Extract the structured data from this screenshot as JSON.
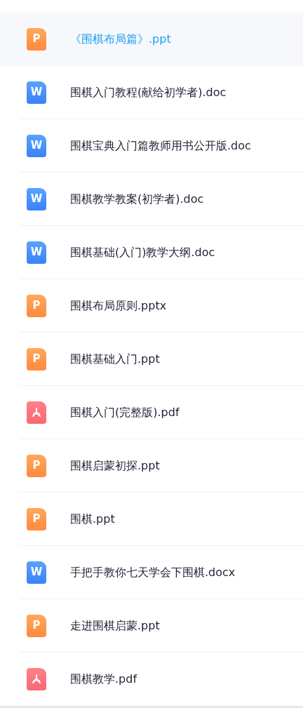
{
  "files": [
    {
      "kind": "ppt",
      "icon_letter": "P",
      "name": "《围棋布局篇》.ppt",
      "selected": true
    },
    {
      "kind": "doc",
      "icon_letter": "W",
      "name": "围棋入门教程(献给初学者).doc",
      "selected": false
    },
    {
      "kind": "doc",
      "icon_letter": "W",
      "name": "围棋宝典入门篇教师用书公开版.doc",
      "selected": false
    },
    {
      "kind": "doc",
      "icon_letter": "W",
      "name": "围棋教学教案(初学者).doc",
      "selected": false
    },
    {
      "kind": "doc",
      "icon_letter": "W",
      "name": "围棋基础(入门)教学大纲.doc",
      "selected": false
    },
    {
      "kind": "ppt",
      "icon_letter": "P",
      "name": "围棋布局原则.pptx",
      "selected": false
    },
    {
      "kind": "ppt",
      "icon_letter": "P",
      "name": "围棋基础入门.ppt",
      "selected": false
    },
    {
      "kind": "pdf",
      "name": "围棋入门(完整版).pdf",
      "selected": false
    },
    {
      "kind": "ppt",
      "icon_letter": "P",
      "name": "围棋启蒙初探.ppt",
      "selected": false
    },
    {
      "kind": "ppt",
      "icon_letter": "P",
      "name": "围棋.ppt",
      "selected": false
    },
    {
      "kind": "doc",
      "icon_letter": "W",
      "name": "手把手教你七天学会下围棋.docx",
      "selected": false
    },
    {
      "kind": "ppt",
      "icon_letter": "P",
      "name": "走进围棋启蒙.ppt",
      "selected": false
    },
    {
      "kind": "pdf",
      "name": "围棋教学.pdf",
      "selected": false
    }
  ]
}
